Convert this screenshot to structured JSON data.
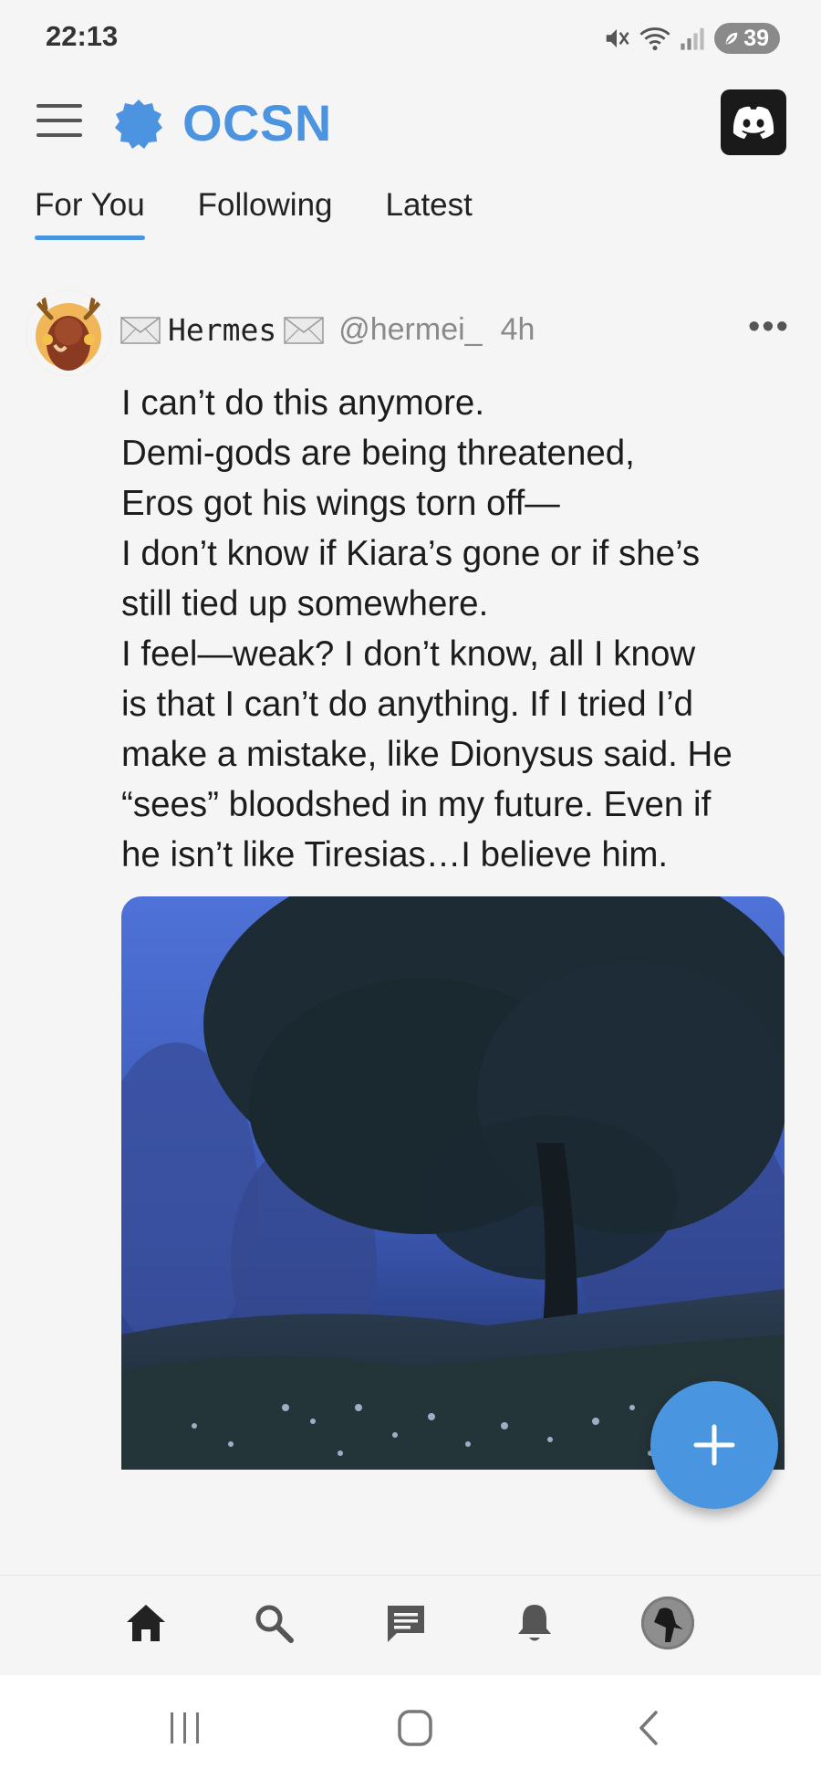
{
  "status_bar": {
    "time": "22:13",
    "battery": "39",
    "icons": [
      "mute-icon",
      "wifi-icon",
      "signal-icon",
      "battery-icon"
    ]
  },
  "header": {
    "brand": "OCSN",
    "brand_color": "#4c94e0",
    "icons": [
      "menu-icon",
      "brand-logo-icon",
      "discord-icon"
    ]
  },
  "tabs": [
    {
      "label": "For You",
      "active": true
    },
    {
      "label": "Following",
      "active": false
    },
    {
      "label": "Latest",
      "active": false
    }
  ],
  "post": {
    "display_name": "Hermes",
    "handle": "@hermei_",
    "time": "4h",
    "more": "•••",
    "lines": [
      "I can’t do this anymore.",
      "Demi-gods are being threatened,",
      "Eros got his wings torn off—",
      "I don’t know if Kiara’s gone or if she’s",
      "still tied up somewhere.",
      "I feel—weak? I don’t know, all I know",
      "is that I can’t do anything. If I tried I’d",
      "make a mistake, like Dionysus said. He",
      "“sees” bloodshed in my future. Even if",
      "he isn’t like Tiresias…I believe him."
    ]
  },
  "fab": {
    "icon": "plus-icon",
    "color": "#4a95e0"
  },
  "bottom_nav": [
    "home-icon",
    "search-icon",
    "messages-icon",
    "notifications-icon",
    "profile-avatar"
  ],
  "system_nav": [
    "recents-icon",
    "home-button-icon",
    "back-icon"
  ]
}
